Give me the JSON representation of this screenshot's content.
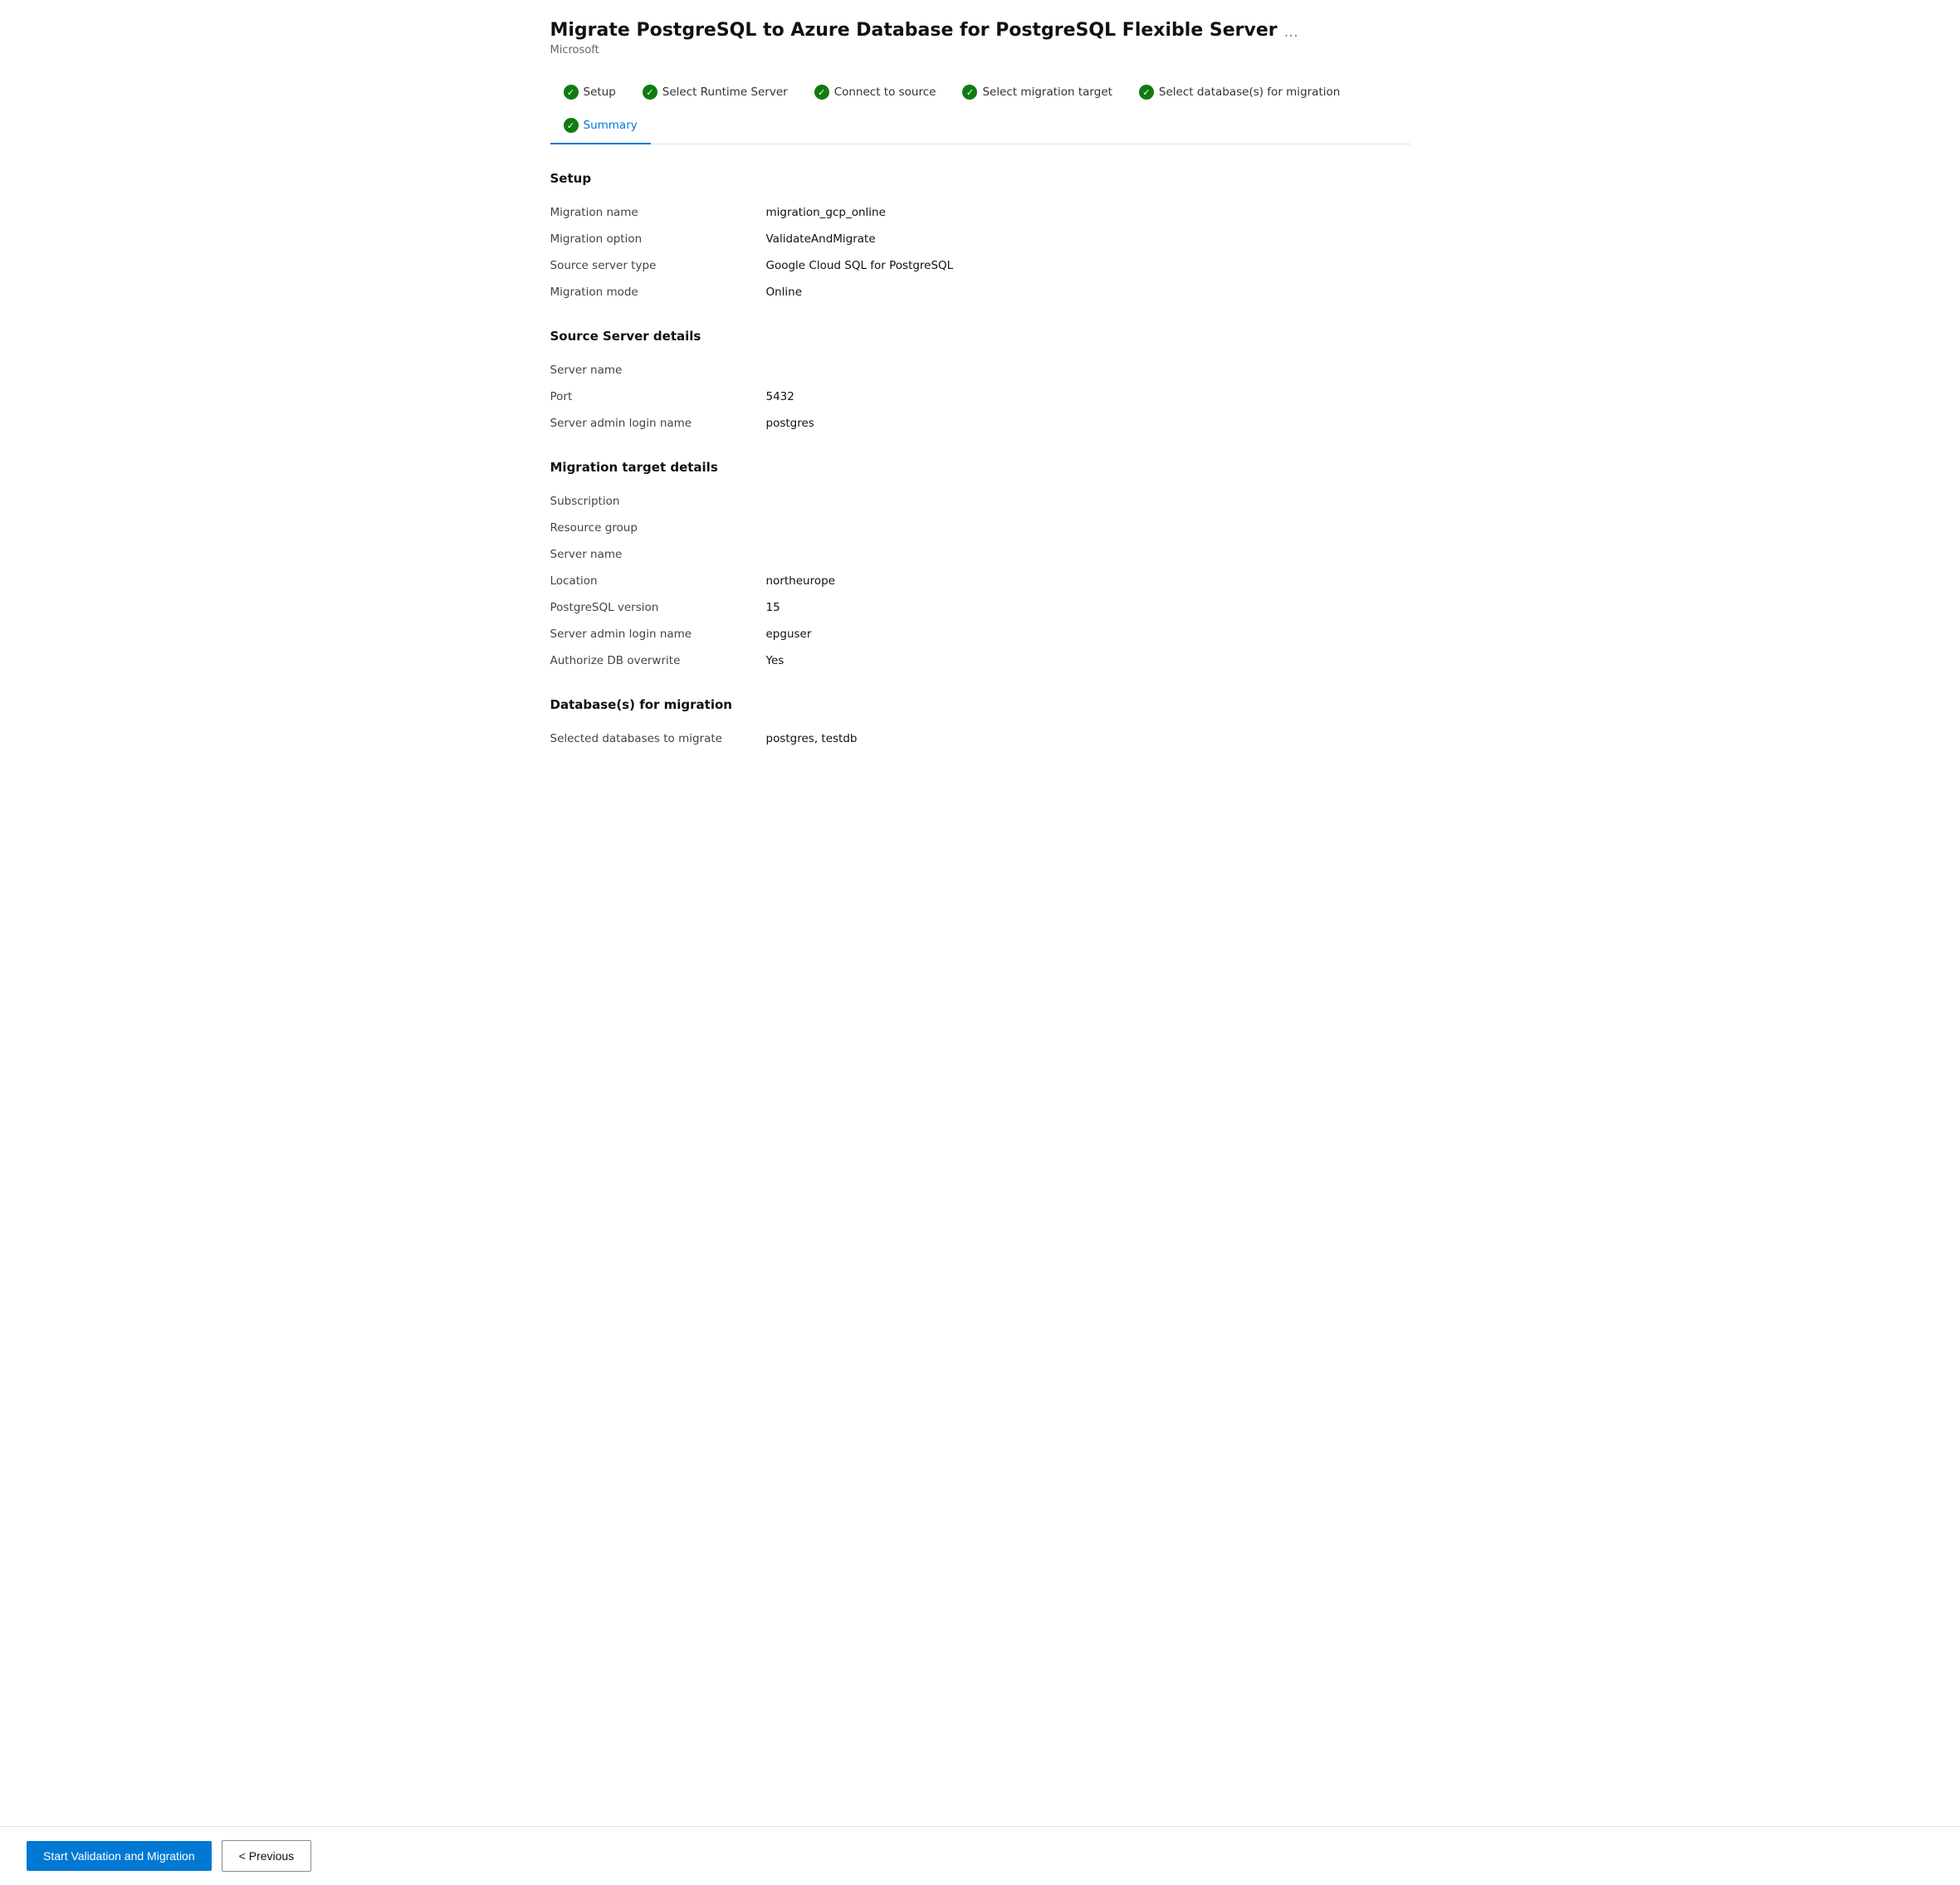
{
  "header": {
    "title": "Migrate PostgreSQL to Azure Database for PostgreSQL Flexible Server",
    "subtitle": "Microsoft",
    "more_label": "..."
  },
  "wizard": {
    "steps": [
      {
        "id": "setup",
        "label": "Setup",
        "completed": true,
        "active": false
      },
      {
        "id": "runtime",
        "label": "Select Runtime Server",
        "completed": true,
        "active": false
      },
      {
        "id": "source",
        "label": "Connect to source",
        "completed": true,
        "active": false
      },
      {
        "id": "target",
        "label": "Select migration target",
        "completed": true,
        "active": false
      },
      {
        "id": "databases",
        "label": "Select database(s) for migration",
        "completed": true,
        "active": false
      },
      {
        "id": "summary",
        "label": "Summary",
        "completed": true,
        "active": true
      }
    ]
  },
  "sections": {
    "setup": {
      "heading": "Setup",
      "fields": [
        {
          "label": "Migration name",
          "value": "migration_gcp_online"
        },
        {
          "label": "Migration option",
          "value": "ValidateAndMigrate"
        },
        {
          "label": "Source server type",
          "value": "Google Cloud SQL for PostgreSQL"
        },
        {
          "label": "Migration mode",
          "value": "Online"
        }
      ]
    },
    "source": {
      "heading": "Source Server details",
      "fields": [
        {
          "label": "Server name",
          "value": ""
        },
        {
          "label": "Port",
          "value": "5432"
        },
        {
          "label": "Server admin login name",
          "value": "postgres"
        }
      ]
    },
    "target": {
      "heading": "Migration target details",
      "fields": [
        {
          "label": "Subscription",
          "value": ""
        },
        {
          "label": "Resource group",
          "value": ""
        },
        {
          "label": "Server name",
          "value": ""
        },
        {
          "label": "Location",
          "value": "northeurope"
        },
        {
          "label": "PostgreSQL version",
          "value": "15"
        },
        {
          "label": "Server admin login name",
          "value": "epguser"
        },
        {
          "label": "Authorize DB overwrite",
          "value": "Yes"
        }
      ]
    },
    "databases": {
      "heading": "Database(s) for migration",
      "fields": [
        {
          "label": "Selected databases to migrate",
          "value": "postgres, testdb"
        }
      ]
    }
  },
  "footer": {
    "start_button": "Start Validation and Migration",
    "previous_button": "< Previous"
  }
}
